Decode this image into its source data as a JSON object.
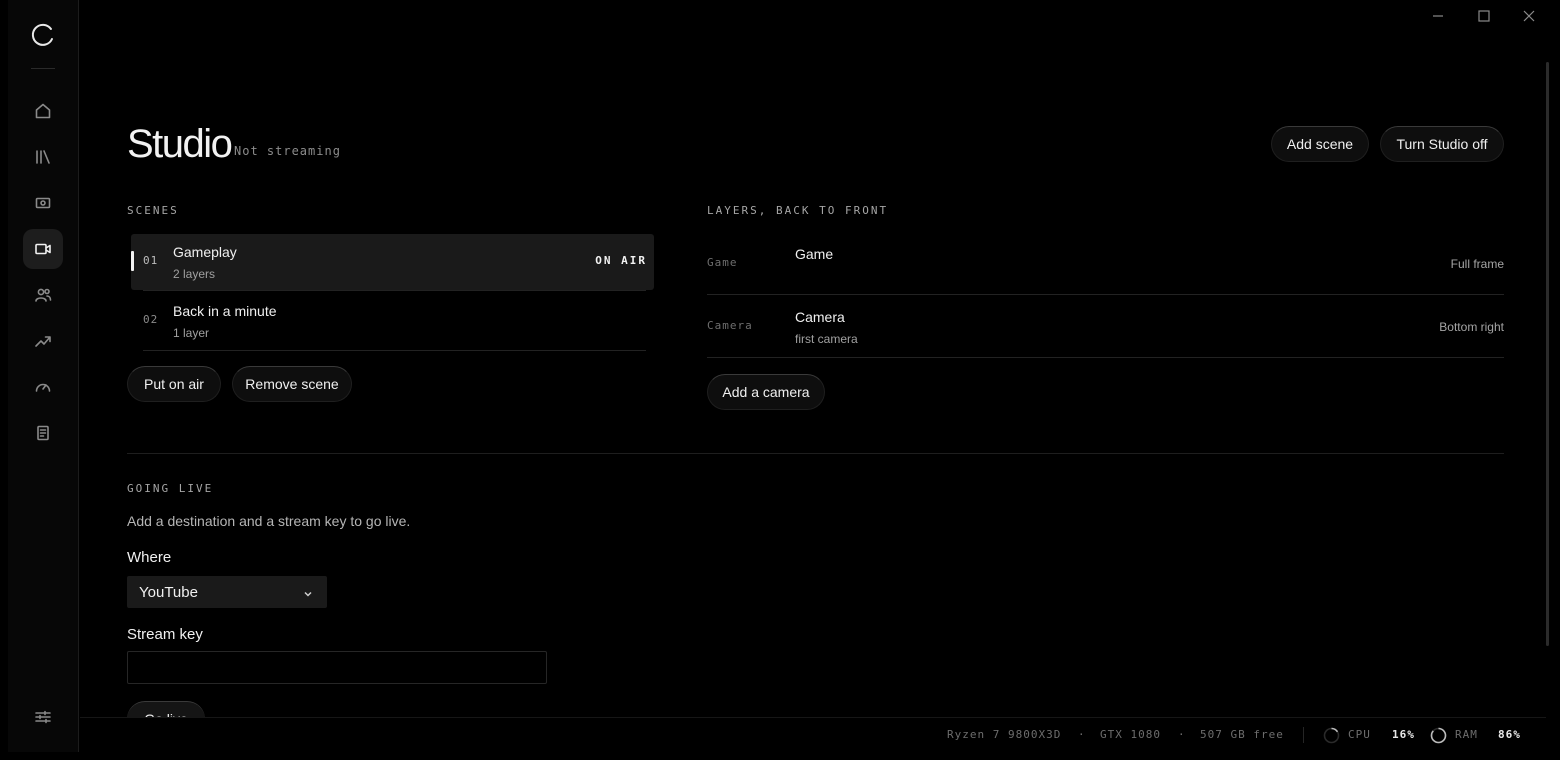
{
  "app": {
    "window_controls": [
      "minimize-icon",
      "maximize-icon",
      "close-icon"
    ]
  },
  "sidebar": {
    "logo_icon": "loading-ring-logo",
    "items": [
      {
        "icon": "home-icon",
        "active": false
      },
      {
        "icon": "library-icon",
        "active": false
      },
      {
        "icon": "capture-icon",
        "active": false
      },
      {
        "icon": "video-camera-icon",
        "active": true
      },
      {
        "icon": "people-icon",
        "active": false
      },
      {
        "icon": "trending-icon",
        "active": false
      },
      {
        "icon": "gauge-icon",
        "active": false
      },
      {
        "icon": "document-icon",
        "active": false
      }
    ],
    "bottom_icon": "sliders-icon"
  },
  "header": {
    "title": "Studio",
    "status": "Not streaming",
    "add_scene": "Add scene",
    "turn_off": "Turn Studio off"
  },
  "scenes": {
    "label": "SCENES",
    "items": [
      {
        "num": "01",
        "name": "Gameplay",
        "layers": "2 layers",
        "badge": "ON AIR",
        "active": true
      },
      {
        "num": "02",
        "name": "Back in a minute",
        "layers": "1 layer",
        "badge": "",
        "active": false
      }
    ],
    "put_on_air": "Put on air",
    "remove_scene": "Remove scene"
  },
  "layers": {
    "label": "LAYERS, BACK TO FRONT",
    "items": [
      {
        "kind": "Game",
        "name": "Game",
        "sub": "",
        "position": "Full frame"
      },
      {
        "kind": "Camera",
        "name": "Camera",
        "sub": "first camera",
        "position": "Bottom right"
      }
    ],
    "add_camera": "Add a camera"
  },
  "going_live": {
    "label": "GOING LIVE",
    "description": "Add a destination and a stream key to go live.",
    "where_label": "Where",
    "where_value": "YouTube",
    "stream_key_label": "Stream key",
    "stream_key_value": "",
    "go_live": "Go live"
  },
  "status_bar": {
    "cpu_model": "Ryzen 7 9800X3D",
    "sep": "·",
    "gpu_model": "GTX 1080",
    "disk": "507 GB free",
    "cpu_label": "CPU",
    "cpu_value": "16%",
    "cpu_fraction": 0.16,
    "ram_label": "RAM",
    "ram_value": "86%",
    "ram_fraction": 0.86
  },
  "colors": {
    "background": "#000000",
    "sidebar": "#070707",
    "active_row": "#1a1a1a",
    "text": "#f0f0f0",
    "muted": "#8c8c8c"
  }
}
